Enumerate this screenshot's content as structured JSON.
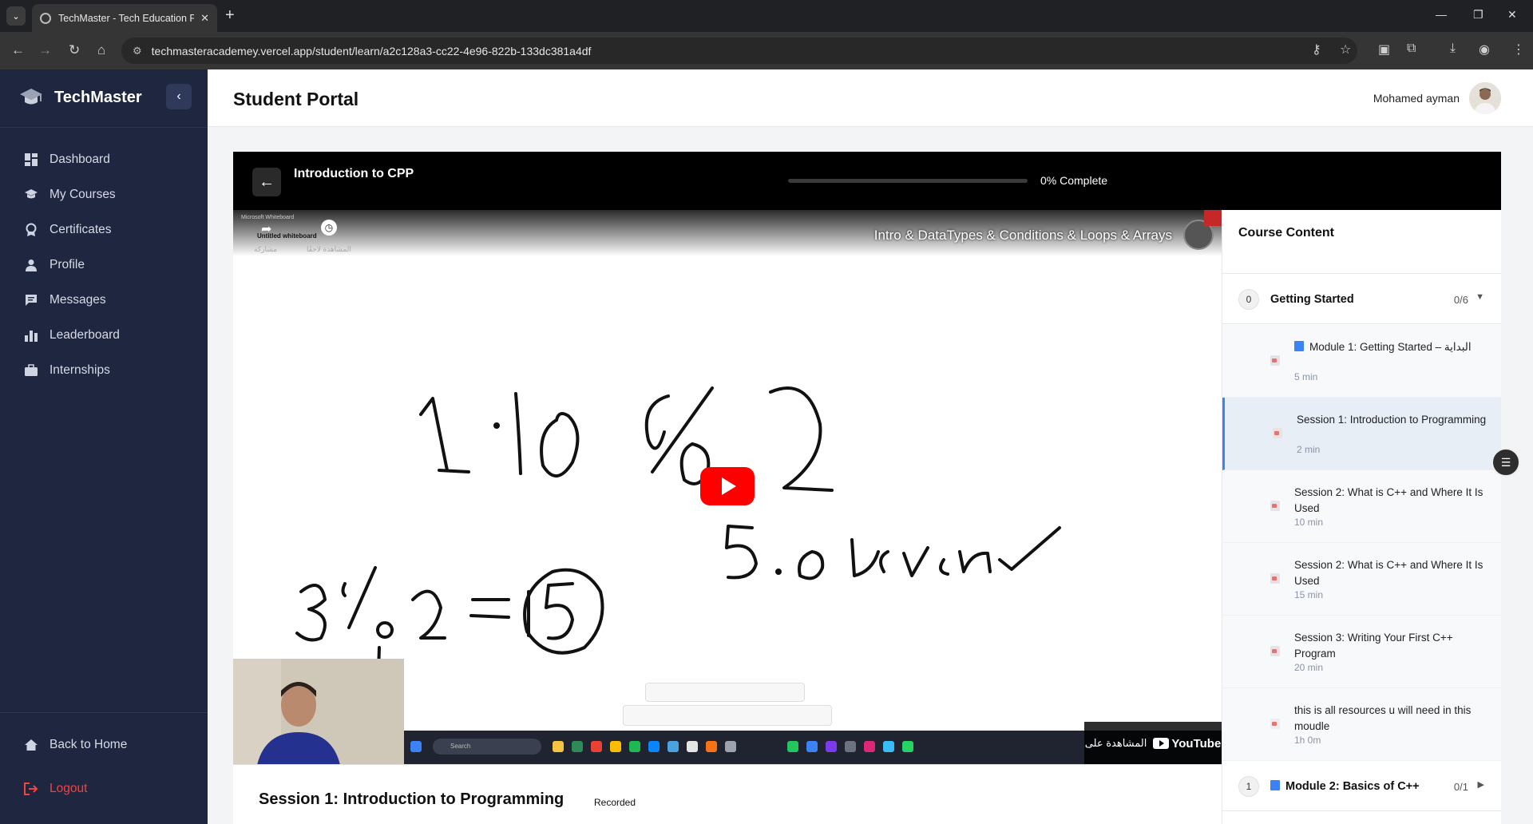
{
  "browser": {
    "tab_title": "TechMaster - Tech Education Pl",
    "url": "techmasteracademey.vercel.app/student/learn/a2c128a3-cc22-4e96-822b-133dc381a4df"
  },
  "sidebar": {
    "brand": "TechMaster",
    "items": [
      {
        "label": "Dashboard",
        "icon": "dashboard-icon"
      },
      {
        "label": "My Courses",
        "icon": "graduation-cap-icon"
      },
      {
        "label": "Certificates",
        "icon": "award-icon"
      },
      {
        "label": "Profile",
        "icon": "user-icon"
      },
      {
        "label": "Messages",
        "icon": "message-icon"
      },
      {
        "label": "Leaderboard",
        "icon": "bar-chart-icon"
      },
      {
        "label": "Internships",
        "icon": "briefcase-icon"
      }
    ],
    "back_home": "Back to Home",
    "logout": "Logout"
  },
  "header": {
    "title": "Student Portal",
    "user_name": "Mohamed ayman"
  },
  "player": {
    "course_title": "Introduction to CPP",
    "progress_percent": 0,
    "progress_text": "0% Complete",
    "video": {
      "title": "Intro & DataTypes & Conditions & Loops & Arrays",
      "whiteboard_app": "Microsoft Whiteboard",
      "whiteboard_title": "Untitled whiteboard",
      "share_label": "مشاركة",
      "watch_later_label": "المشاهدة لاحقًا",
      "taskbar_search": "Search",
      "watch_on": "المشاهدة على",
      "youtube": "YouTube"
    },
    "session_title": "Session 1: Introduction to Programming",
    "session_badge": "Recorded"
  },
  "course_content": {
    "title": "Course Content",
    "modules": [
      {
        "index": "0",
        "title": "Getting Started",
        "count": "0/6",
        "lessons": [
          {
            "title": "Module 1: Getting Started – البداية",
            "duration": "5 min"
          },
          {
            "title": "Session 1: Introduction to Programming",
            "duration": "2 min"
          },
          {
            "title": "Session 2: What is C++ and Where It Is Used",
            "duration": "10 min"
          },
          {
            "title": "Session 2: What is C++ and Where It Is Used",
            "duration": "15 min"
          },
          {
            "title": "Session 3: Writing Your First C++ Program",
            "duration": "20 min"
          },
          {
            "title": "this is all resources u will need in this moudle",
            "duration": "1h 0m"
          }
        ]
      },
      {
        "index": "1",
        "title": "Module 2: Basics of C++",
        "count": "0/1"
      }
    ]
  }
}
